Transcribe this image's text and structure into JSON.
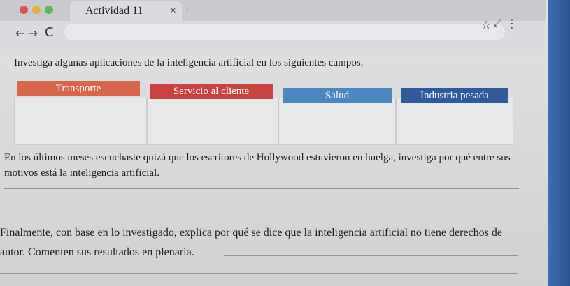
{
  "browser": {
    "tab_title": "Actividad 11",
    "tab_close": "×",
    "tab_new": "+",
    "nav_arrows": "← →",
    "reload": "C",
    "star": "☆",
    "menu": "⋮",
    "resize": "⤢"
  },
  "content": {
    "instruction": "Investiga algunas aplicaciones de la inteligencia artificial en los siguientes campos.",
    "categories": [
      {
        "label": "Transporte",
        "color": "#d9664a"
      },
      {
        "label": "Servicio al cliente",
        "color": "#c9423e"
      },
      {
        "label": "Salud",
        "color": "#4a88c2"
      },
      {
        "label": "Industria pesada",
        "color": "#2f5a9e"
      }
    ],
    "question1": "En los últimos meses escuchaste quizá que los escritores de Hollywood estuvieron en huelga, investiga por qué entre sus motivos está la inteligencia artificial.",
    "question2": "Finalmente, con base en lo investigado, explica por qué se dice que la inteligencia artificial no tiene derechos de autor. Comenten sus resultados en plenaria."
  }
}
